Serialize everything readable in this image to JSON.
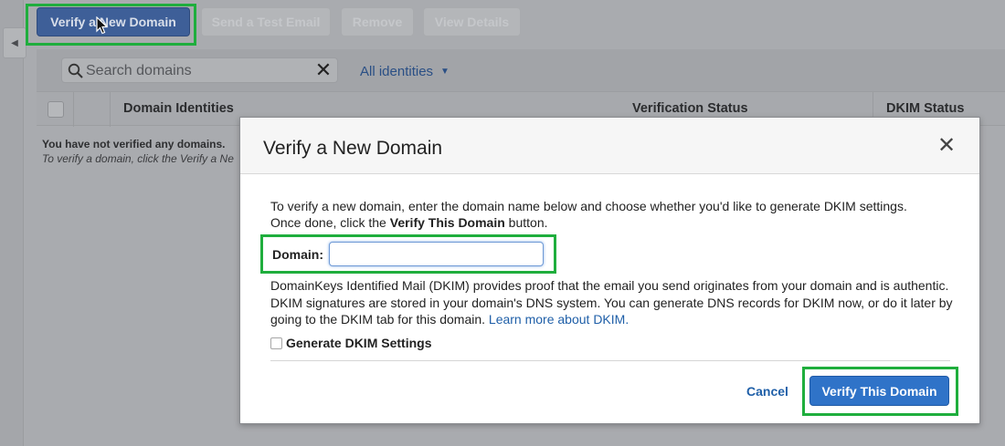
{
  "toolbar": {
    "verify_new_domain": "Verify a New Domain",
    "send_test_email": "Send a Test Email",
    "remove": "Remove",
    "view_details": "View Details"
  },
  "filter": {
    "search_placeholder": "Search domains",
    "identity_filter": "All identities"
  },
  "table": {
    "columns": [
      "Domain Identities",
      "Verification Status",
      "DKIM Status"
    ],
    "empty_title": "You have not verified any domains.",
    "empty_hint": "To verify a domain, click the Verify a Ne"
  },
  "modal": {
    "title": "Verify a New Domain",
    "intro_line1": "To verify a new domain, enter the domain name below and choose whether you'd like to generate DKIM settings.",
    "intro_line2_prefix": "Once done, click the ",
    "intro_line2_bold": "Verify This Domain",
    "intro_line2_suffix": " button.",
    "domain_label": "Domain:",
    "domain_value": "",
    "dkim_text": "DomainKeys Identified Mail (DKIM) provides proof that the email you send originates from your domain and is authentic. DKIM signatures are stored in your domain's DNS system. You can generate DNS records for DKIM now, or do it later by going to the DKIM tab for this domain.",
    "learn_more": "Learn more about DKIM.",
    "generate_dkim_label": "Generate DKIM Settings",
    "generate_dkim_checked": false,
    "cancel": "Cancel",
    "verify_button": "Verify This Domain"
  },
  "colors": {
    "highlight": "#1fae3d",
    "primary_button": "#2f73c8",
    "link": "#1f5fa8"
  },
  "icons": {
    "side_toggle": "chevron-left-icon",
    "search": "search-icon",
    "clear": "close-icon",
    "dropdown": "chevron-down-icon",
    "modal_close": "close-icon",
    "pointer": "mouse-cursor-icon"
  }
}
